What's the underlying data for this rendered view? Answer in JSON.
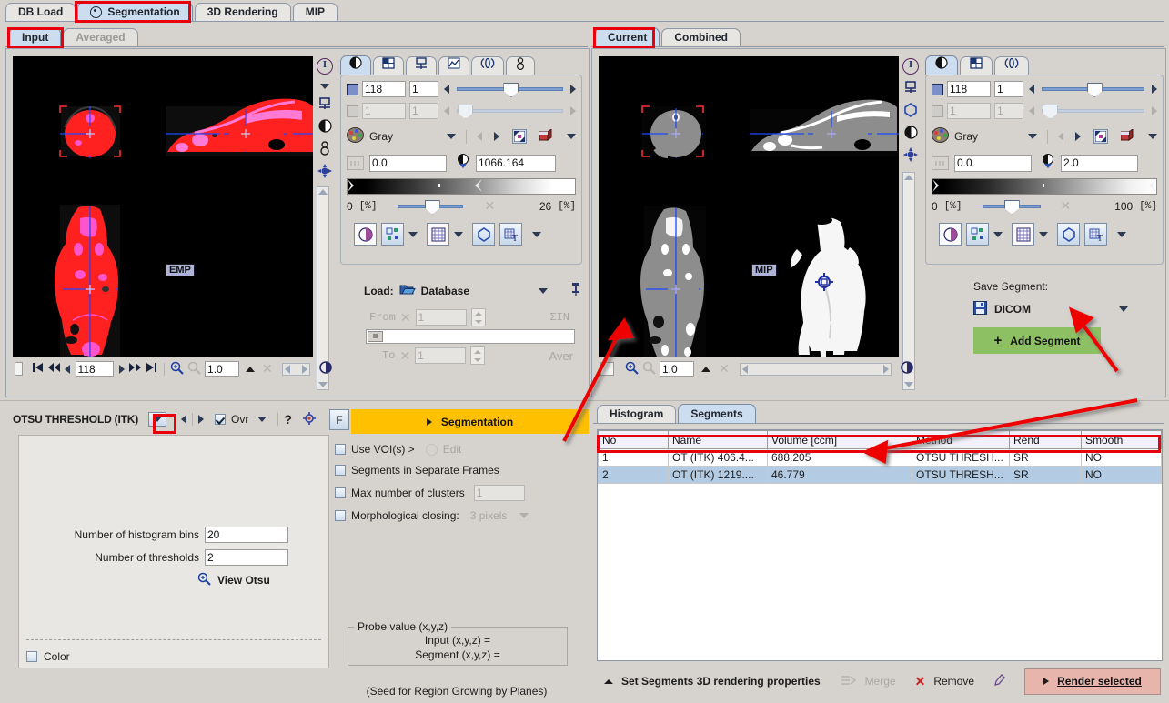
{
  "main_tabs": [
    {
      "label": "DB Load",
      "selected": false,
      "icon": null
    },
    {
      "label": "Segmentation",
      "selected": true,
      "icon": "target-icon"
    },
    {
      "label": "3D Rendering",
      "selected": false,
      "icon": null
    },
    {
      "label": "MIP",
      "selected": false,
      "icon": null
    }
  ],
  "left": {
    "sub_tabs": [
      {
        "label": "Input",
        "selected": true
      },
      {
        "label": "Averaged",
        "selected": false,
        "disabled": true
      }
    ],
    "image_overlay_label": "EMP",
    "side_icons": [
      "info-icon",
      "chevron-down-icon",
      "crosshair-tool-icon",
      "contrast-icon",
      "thermometer-icon",
      "marker-icon"
    ],
    "control_tabs": [
      "contrast-icon",
      "layout-icon",
      "crosshair-tool-icon",
      "curve-icon",
      "motion-icon",
      "thermometer-icon"
    ],
    "slice_value": "118",
    "slice_step": "1",
    "frame_value": "1",
    "frame_step": "1",
    "palette_name": "Gray",
    "level_min": "0.0",
    "level_max": "1066.164",
    "pct_min": "0",
    "pct_min_unit": "[%]",
    "pct_max": "26",
    "pct_max_unit": "[%]",
    "load_label": "Load:",
    "load_source": "Database",
    "from_label": "From",
    "from_value": "1",
    "to_label": "To",
    "to_value": "1",
    "sum_label": "ΣIN",
    "aver_label": "Aver",
    "nav_slice": "118",
    "nav_zoom": "1.0"
  },
  "right": {
    "sub_tabs": [
      {
        "label": "Current",
        "selected": true
      },
      {
        "label": "Combined",
        "selected": false
      }
    ],
    "image_overlay_label": "MIP",
    "side_icons": [
      "info-icon",
      "crosshair-tool-icon",
      "circle-icon",
      "contrast-icon",
      "marker-icon"
    ],
    "control_tabs": [
      "contrast-icon",
      "layout-icon",
      "motion-icon"
    ],
    "slice_value": "118",
    "slice_step": "1",
    "frame_value": "1",
    "frame_step": "1",
    "palette_name": "Gray",
    "level_min": "0.0",
    "level_max": "2.0",
    "pct_min": "0",
    "pct_min_unit": "[%]",
    "pct_max": "100",
    "pct_max_unit": "[%]",
    "save_segment_label": "Save Segment:",
    "save_format": "DICOM",
    "add_segment_label": "Add Segment",
    "add_segment_color": "#8dc063",
    "nav_zoom": "1.0"
  },
  "otsu": {
    "title": "OTSU THRESHOLD (ITK)",
    "ovr_label": "Ovr",
    "ovr_checked": true,
    "help_label": "?",
    "hist_bins_label": "Number of histogram bins",
    "hist_bins_value": "20",
    "thresholds_label": "Number of thresholds",
    "thresholds_value": "2",
    "view_otsu_label": "View Otsu",
    "color_label": "Color",
    "color_checked": false
  },
  "segmentation": {
    "f_button": "F",
    "action_label": "Segmentation",
    "action_color": "#ffc000",
    "options": [
      {
        "label": "Use VOI(s) >",
        "checked": false,
        "extra": "Edit",
        "extra_type": "radio",
        "disabled_extra": true
      },
      {
        "label": "Segments in Separate Frames",
        "checked": false
      },
      {
        "label": "Max number of clusters",
        "checked": false,
        "field": "1",
        "field_disabled": true
      },
      {
        "label": "Morphological closing:",
        "checked": false,
        "combo": "3 pixels",
        "combo_disabled": true
      }
    ],
    "probe_title": "Probe value (x,y,z)",
    "probe_input": "Input (x,y,z) =",
    "probe_segment": "Segment (x,y,z) =",
    "seed_note": "(Seed for Region Growing by Planes)"
  },
  "results": {
    "tabs": [
      {
        "label": "Histogram",
        "selected": false
      },
      {
        "label": "Segments",
        "selected": true
      }
    ],
    "columns": [
      "No",
      "Name",
      "Volume [ccm]",
      "Method",
      "Rend",
      "Smooth"
    ],
    "rows": [
      {
        "no": "1",
        "name": "OT (ITK) 406.4...",
        "volume": "688.205",
        "method": "OTSU THRESH...",
        "rend": "SR",
        "smooth": "NO",
        "selected": false
      },
      {
        "no": "2",
        "name": "OT (ITK) 1219....",
        "volume": "46.779",
        "method": "OTSU THRESH...",
        "rend": "SR",
        "smooth": "NO",
        "selected": true
      }
    ],
    "footer": {
      "set_props_label": "Set Segments 3D rendering properties",
      "merge_label": "Merge",
      "remove_label": "Remove",
      "render_label": "Render selected",
      "render_color": "#e8b5ad"
    }
  }
}
